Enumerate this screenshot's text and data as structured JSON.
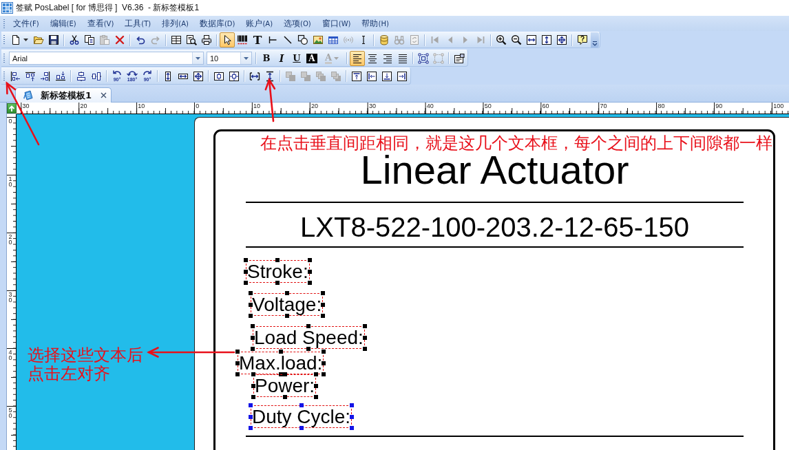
{
  "window": {
    "title": "签赋 PosLabel [ for 博思得 ]  V6.36  - 新标签模板1"
  },
  "menu": [
    {
      "label": "文件",
      "hotkey": "(F)"
    },
    {
      "label": "编辑",
      "hotkey": "(E)"
    },
    {
      "label": "查看",
      "hotkey": "(V)"
    },
    {
      "label": "工具",
      "hotkey": "(T)"
    },
    {
      "label": "排列",
      "hotkey": "(A)"
    },
    {
      "label": "数据库",
      "hotkey": "(D)"
    },
    {
      "label": "账户",
      "hotkey": "(A)"
    },
    {
      "label": "选项",
      "hotkey": "(O)"
    },
    {
      "label": "窗口",
      "hotkey": "(W)"
    },
    {
      "label": "帮助",
      "hotkey": "(H)"
    }
  ],
  "toolbars": [
    {
      "overflow": true,
      "groups": [
        [
          {
            "kind": "new",
            "disabled": false
          },
          {
            "kind": "open",
            "disabled": false
          },
          {
            "kind": "save",
            "disabled": false
          }
        ],
        [
          {
            "kind": "cut",
            "disabled": false
          },
          {
            "kind": "copy",
            "disabled": false
          },
          {
            "kind": "paste",
            "disabled": true
          },
          {
            "kind": "delete",
            "disabled": false
          }
        ],
        [
          {
            "kind": "undo",
            "disabled": false
          },
          {
            "kind": "redo",
            "disabled": true
          }
        ],
        [
          {
            "kind": "page-setup",
            "disabled": false
          },
          {
            "kind": "print-preview",
            "disabled": false
          },
          {
            "kind": "print",
            "disabled": false
          }
        ],
        [
          {
            "kind": "pointer",
            "selected": true,
            "disabled": false
          },
          {
            "kind": "barcode",
            "selected": false,
            "disabled": false
          },
          {
            "kind": "text",
            "label": "T",
            "selected": false,
            "disabled": false
          },
          {
            "kind": "hline",
            "selected": false,
            "disabled": false
          },
          {
            "kind": "line",
            "selected": false,
            "disabled": false
          },
          {
            "kind": "shape",
            "selected": false,
            "disabled": false
          },
          {
            "kind": "image",
            "selected": false,
            "disabled": false
          },
          {
            "kind": "table",
            "selected": false,
            "disabled": false
          },
          {
            "kind": "rfid",
            "selected": false,
            "disabled": true
          },
          {
            "kind": "cursor",
            "selected": false,
            "disabled": false
          }
        ],
        [
          {
            "kind": "database",
            "disabled": false
          },
          {
            "kind": "find",
            "disabled": true
          },
          {
            "kind": "refresh",
            "disabled": true
          }
        ],
        [
          {
            "kind": "first",
            "disabled": true
          },
          {
            "kind": "previous",
            "disabled": true
          },
          {
            "kind": "next",
            "disabled": true
          },
          {
            "kind": "last",
            "disabled": true
          }
        ],
        [
          {
            "kind": "zoom-in",
            "disabled": false
          },
          {
            "kind": "zoom-out",
            "disabled": false
          },
          {
            "kind": "fit-width",
            "disabled": false
          },
          {
            "kind": "fit-height",
            "disabled": false
          },
          {
            "kind": "fit-page",
            "disabled": false
          }
        ],
        [
          {
            "kind": "help",
            "disabled": false
          }
        ]
      ]
    },
    {
      "groups": [
        [
          {
            "kind": "font",
            "value": "Arial",
            "disabled": false
          },
          {
            "kind": "size",
            "value": "10",
            "disabled": false
          }
        ],
        [
          {
            "kind": "bold",
            "label": "B",
            "disabled": false
          },
          {
            "kind": "italic",
            "label": "I",
            "disabled": false
          },
          {
            "kind": "underline",
            "label": "U",
            "disabled": false
          },
          {
            "kind": "inverse",
            "label": "A",
            "disabled": false
          },
          {
            "kind": "text-color",
            "label": "A",
            "disabled": true
          }
        ],
        [
          {
            "kind": "align-left",
            "selected": true,
            "disabled": false
          },
          {
            "kind": "align-center",
            "selected": false,
            "disabled": false
          },
          {
            "kind": "align-right",
            "selected": false,
            "disabled": false
          },
          {
            "kind": "justify",
            "selected": false,
            "disabled": false
          }
        ],
        [
          {
            "kind": "group",
            "disabled": false
          },
          {
            "kind": "ungroup",
            "disabled": true
          }
        ],
        [
          {
            "kind": "properties",
            "disabled": false
          }
        ]
      ]
    },
    {
      "groups": [
        [
          {
            "kind": "align-left-edges",
            "disabled": false
          },
          {
            "kind": "align-top-edges",
            "disabled": false
          },
          {
            "kind": "align-right-edges",
            "disabled": false
          },
          {
            "kind": "align-bottom-edges",
            "disabled": false
          }
        ],
        [
          {
            "kind": "center-horizontal",
            "disabled": false
          },
          {
            "kind": "center-vertical",
            "disabled": false
          }
        ],
        [
          {
            "kind": "rotate-left",
            "label": "90°",
            "disabled": false
          },
          {
            "kind": "rotate-half",
            "label": "180°",
            "disabled": false
          },
          {
            "kind": "rotate-right",
            "label": "90°",
            "disabled": false
          }
        ],
        [
          {
            "kind": "same-height",
            "disabled": false
          },
          {
            "kind": "same-width",
            "disabled": false
          },
          {
            "kind": "same-size",
            "disabled": false
          }
        ],
        [
          {
            "kind": "page-center-horizontal",
            "disabled": false
          },
          {
            "kind": "page-center-vertical",
            "disabled": false
          }
        ],
        [
          {
            "kind": "space-horizontal",
            "disabled": false
          },
          {
            "kind": "space-vertical",
            "disabled": false
          }
        ],
        [
          {
            "kind": "bring-forward",
            "disabled": true
          },
          {
            "kind": "send-backward",
            "disabled": true
          },
          {
            "kind": "bring-to-front",
            "disabled": true
          },
          {
            "kind": "send-to-back",
            "disabled": true
          }
        ],
        [
          {
            "kind": "dock-top",
            "disabled": false
          },
          {
            "kind": "dock-left",
            "disabled": false
          },
          {
            "kind": "dock-bottom",
            "disabled": false
          },
          {
            "kind": "dock-right",
            "disabled": false
          }
        ]
      ]
    }
  ],
  "tabs": [
    {
      "label": "新标签模板1",
      "selected": true
    }
  ],
  "rulers": {
    "horizontal": [
      "30",
      "20",
      "10",
      "0",
      "10",
      "20",
      "30",
      "40",
      "50",
      "60",
      "70",
      "80",
      "90",
      "100"
    ],
    "vertical": [
      "0",
      "10",
      "20",
      "30",
      "40",
      "50"
    ]
  },
  "label": {
    "title": "Linear Actuator",
    "part_number": "LXT8-522-100-203.2-12-65-150",
    "fields": [
      {
        "text": "Stroke:",
        "selected": true,
        "primary": false
      },
      {
        "text": "Voltage:",
        "selected": true,
        "primary": false
      },
      {
        "text": "Load Speed:",
        "selected": true,
        "primary": false
      },
      {
        "text": "Max.load:",
        "selected": true,
        "primary": false
      },
      {
        "text": "Power:",
        "selected": true,
        "primary": false
      },
      {
        "text": "Duty Cycle:",
        "selected": true,
        "primary": true
      }
    ]
  },
  "annotations": [
    {
      "text": "在点击垂直间距相同，就是这几个文本框，每个之间的上下间隙都一样"
    },
    {
      "text": "选择这些文本后点击左对齐"
    }
  ]
}
